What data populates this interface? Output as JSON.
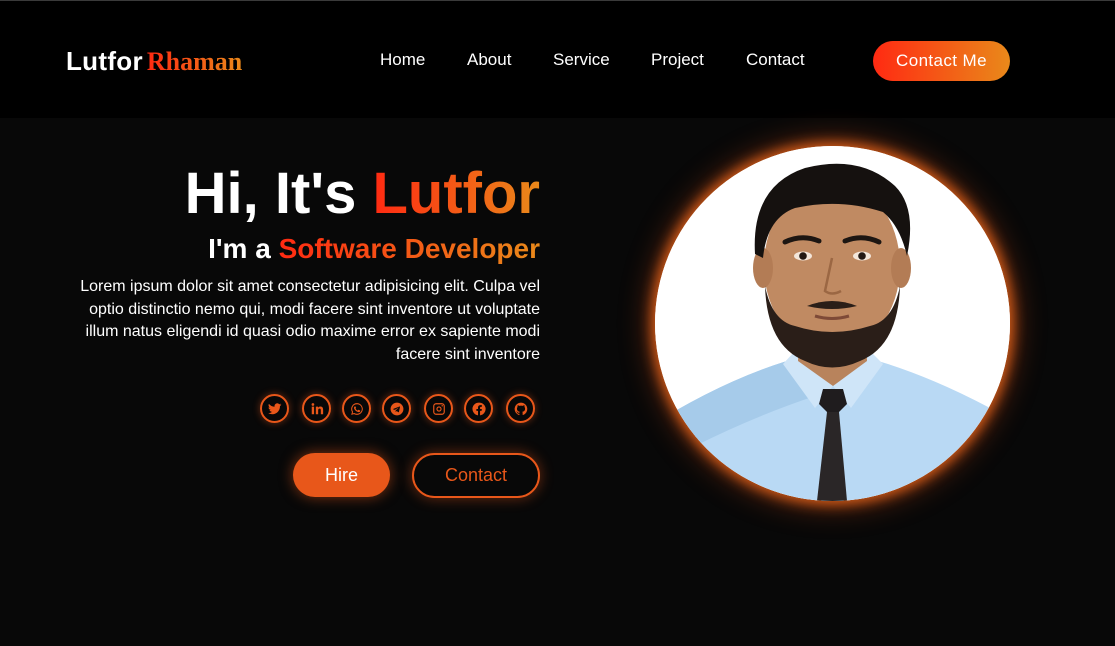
{
  "brand": {
    "first": "Lutfor",
    "last": "Rhaman"
  },
  "nav": {
    "home": "Home",
    "about": "About",
    "service": "Service",
    "project": "Project",
    "contact": "Contact"
  },
  "header_cta": "Contact Me",
  "hero": {
    "greeting": "Hi, It's ",
    "name": "Lutfor",
    "role_prefix": "I'm a ",
    "role": "Software Developer",
    "description": "Lorem ipsum dolor sit amet consectetur adipisicing elit. Culpa vel optio distinctio nemo qui, modi facere sint inventore ut voluptate illum natus eligendi id quasi odio maxime error ex sapiente modi facere sint inventore"
  },
  "social_icons": [
    "twitter-icon",
    "linkedin-icon",
    "whatsapp-icon",
    "telegram-icon",
    "instagram-icon",
    "facebook-icon",
    "github-icon"
  ],
  "buttons": {
    "hire": "Hire",
    "contact": "Contact"
  },
  "colors": {
    "accent": "#e8571a",
    "gradient_start": "#ff2a12",
    "gradient_end": "#e9891a",
    "background": "#080808",
    "header_background": "#000000"
  }
}
